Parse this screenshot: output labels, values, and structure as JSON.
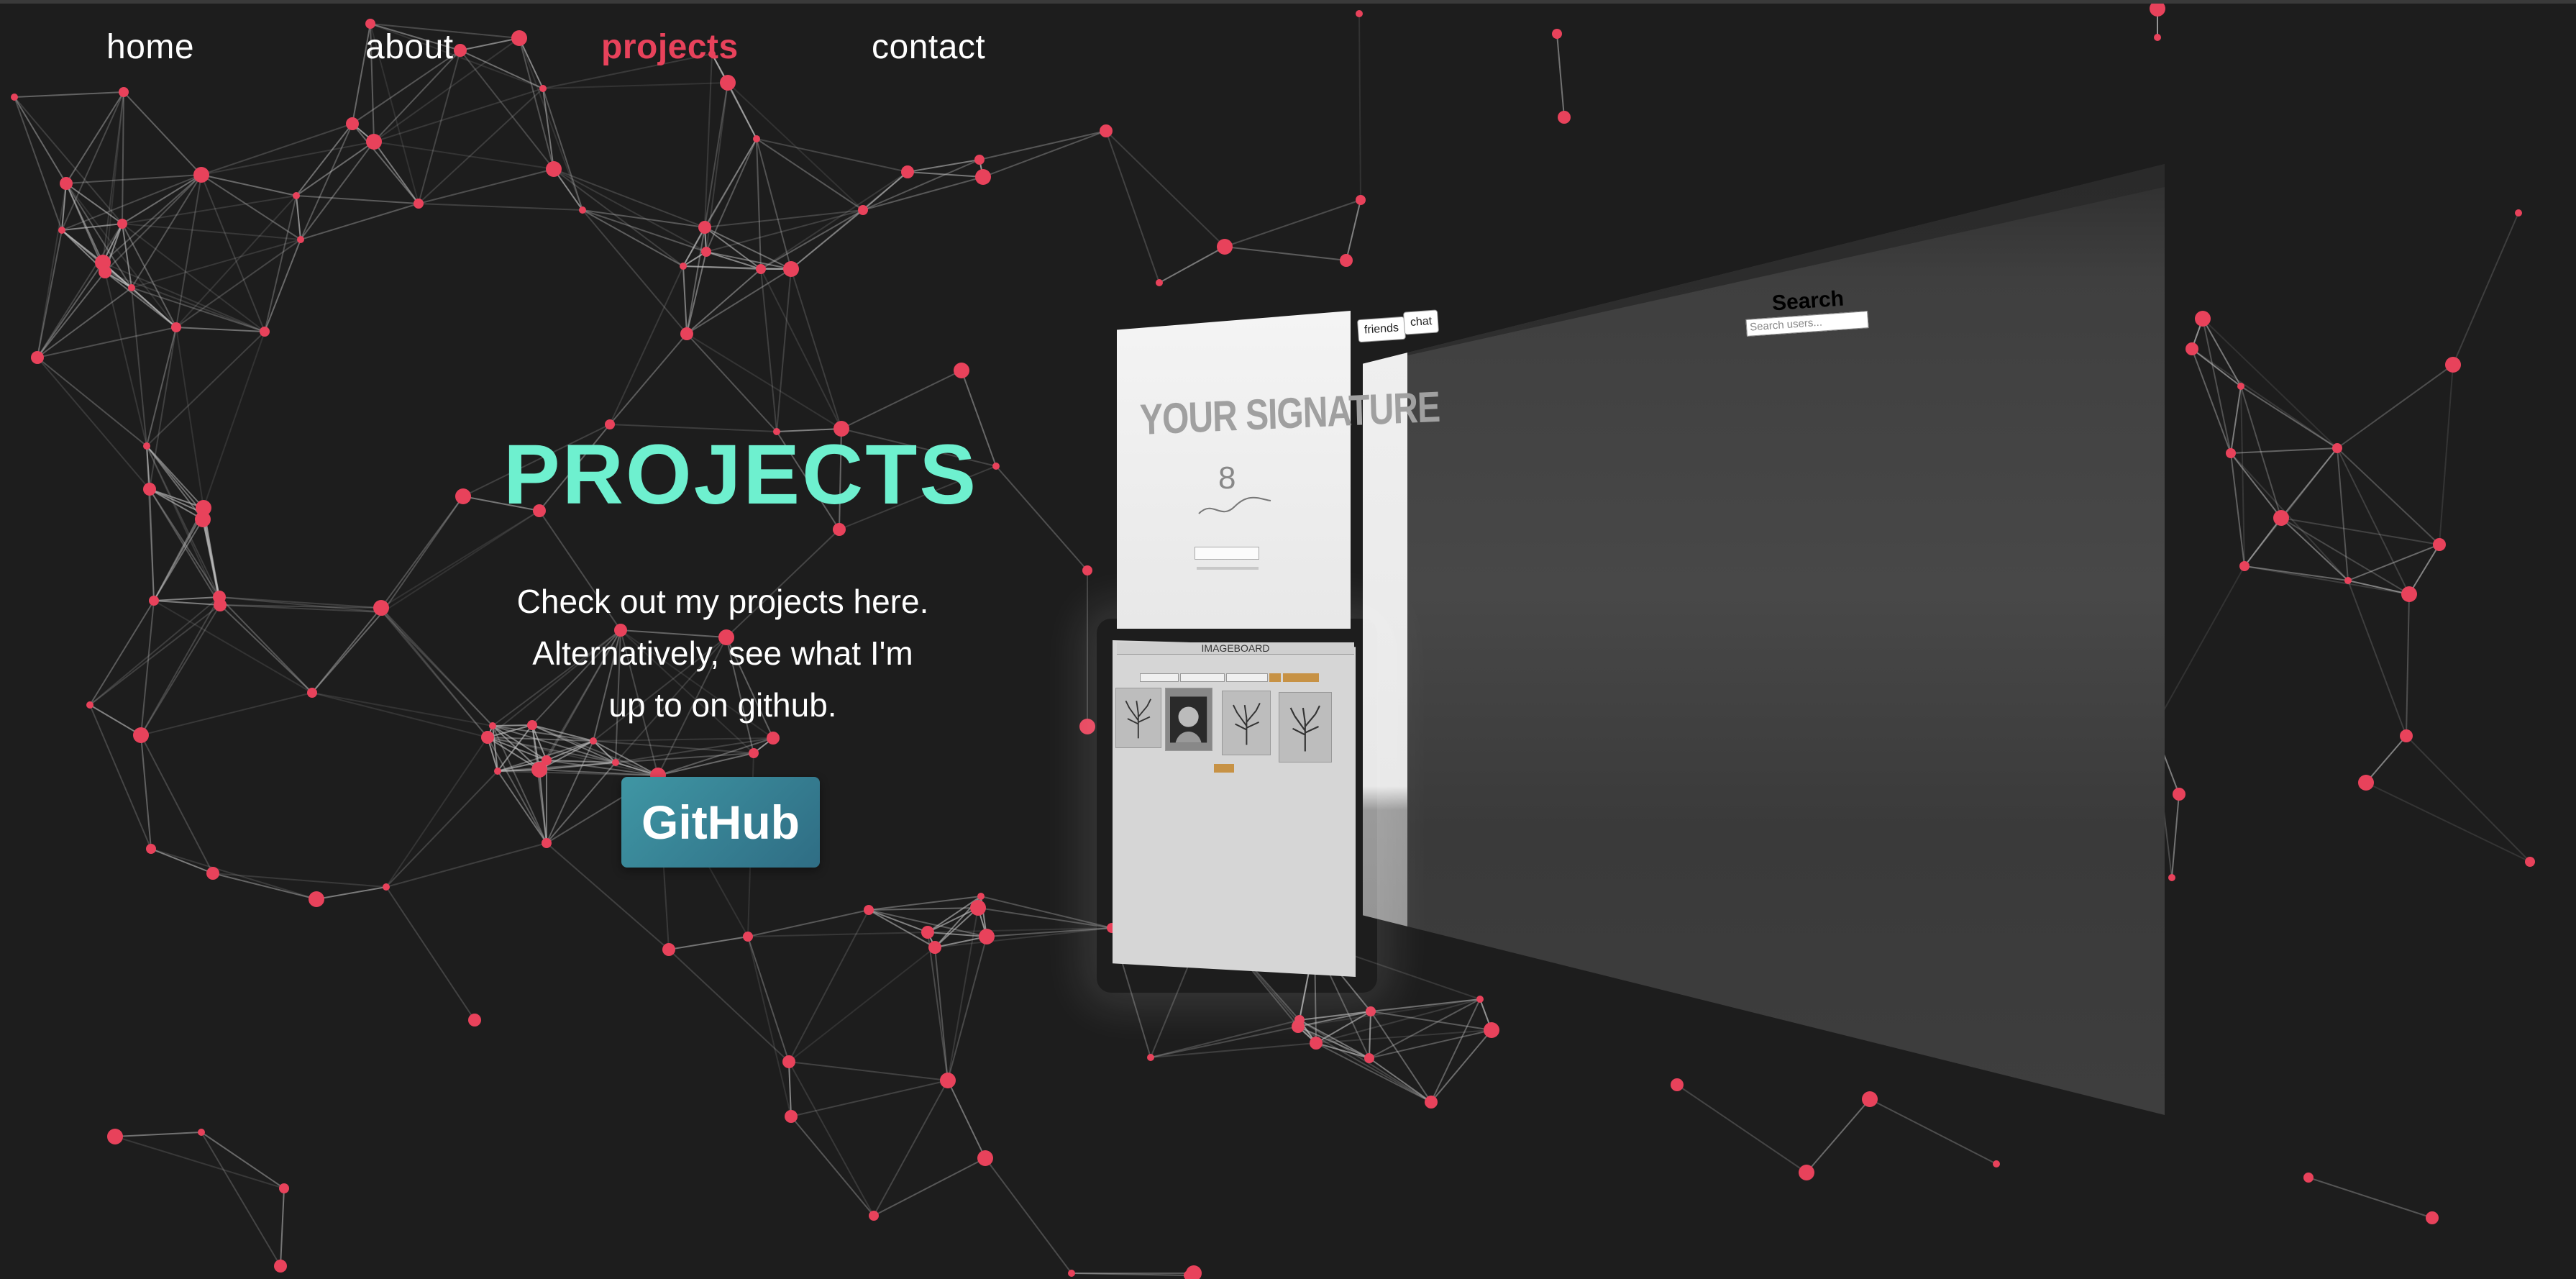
{
  "nav": {
    "items": [
      {
        "label": "home",
        "active": false
      },
      {
        "label": "about",
        "active": false
      },
      {
        "label": "projects",
        "active": true
      },
      {
        "label": "contact",
        "active": false
      }
    ]
  },
  "hero": {
    "title": "PROJECTS",
    "line1": "Check out my projects here.",
    "line2": "Alternatively, see what I'm",
    "line3": "up to on github.",
    "button_label": "GitHub"
  },
  "projects": {
    "search_card": {
      "title": "Search",
      "search_placeholder": "Search users...",
      "tabs": [
        "friends",
        "chat"
      ]
    },
    "signature_card": {
      "title": "YOUR SIGNATURE",
      "count": "8"
    },
    "imageboard_card": {
      "title": "IMAGEBOARD"
    }
  },
  "colors": {
    "background": "#1d1d1d",
    "accent": "#e8425b",
    "title": "#6ef0cf",
    "button": "#3a8598",
    "node": "#e8425b",
    "edge": "#bfbfbf"
  }
}
